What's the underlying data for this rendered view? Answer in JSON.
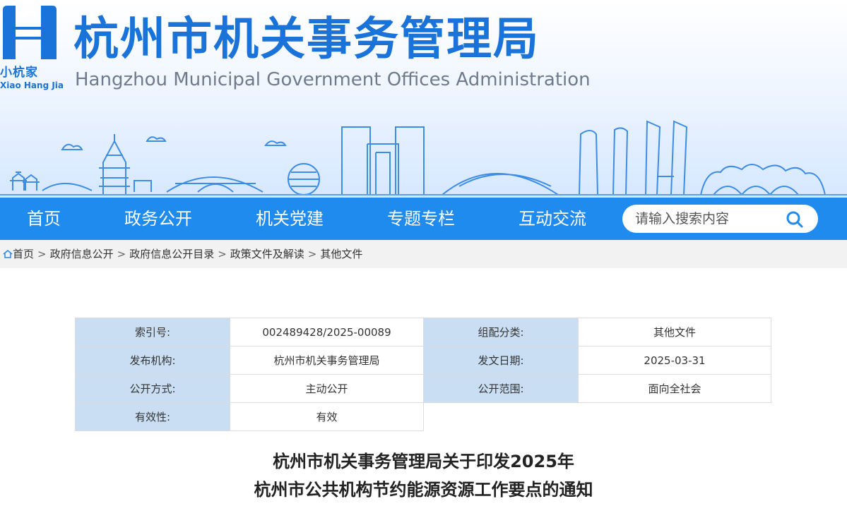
{
  "header": {
    "logo_cn": "小杭家",
    "logo_en": "Xiao Hang Jia",
    "title": "杭州市机关事务管理局",
    "subtitle": "Hangzhou Municipal Government Offices Administration"
  },
  "nav": {
    "items": [
      {
        "label": "首页"
      },
      {
        "label": "政务公开"
      },
      {
        "label": "机关党建"
      },
      {
        "label": "专题专栏"
      },
      {
        "label": "互动交流"
      }
    ],
    "search_placeholder": "请输入搜索内容"
  },
  "breadcrumb": [
    "首页",
    "政府信息公开",
    "政府信息公开目录",
    "政策文件及解读",
    "其他文件"
  ],
  "info": {
    "index_label": "索引号:",
    "index_value": "002489428/2025-00089",
    "category_label": "组配分类:",
    "category_value": "其他文件",
    "issuer_label": "发布机构:",
    "issuer_value": "杭州市机关事务管理局",
    "date_label": "发文日期:",
    "date_value": "2025-03-31",
    "method_label": "公开方式:",
    "method_value": "主动公开",
    "scope_label": "公开范围:",
    "scope_value": "面向全社会",
    "validity_label": "有效性:",
    "validity_value": "有效"
  },
  "article": {
    "title_line1": "杭州市机关事务管理局关于印发2025年",
    "title_line2": "杭州市公共机构节约能源资源工作要点的通知"
  },
  "colors": {
    "brand": "#1a73d9",
    "nav_bg": "#1f8bef",
    "label_bg": "#c9def3"
  }
}
